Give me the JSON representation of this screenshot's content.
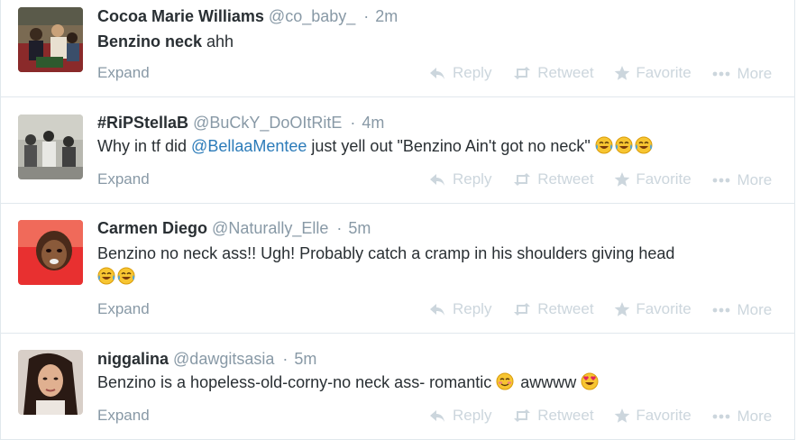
{
  "tweets": [
    {
      "fullname": "Cocoa Marie Williams",
      "username": "@co_baby_",
      "sep": "·",
      "time": "2m",
      "text_bold": "Benzino neck",
      "text_rest": " ahh",
      "expand": "Expand",
      "actions": {
        "reply": "Reply",
        "retweet": "Retweet",
        "favorite": "Favorite",
        "more": "More"
      }
    },
    {
      "fullname": "#RiPStellaB",
      "username": "@BuCkY_DoOItRitE",
      "sep": "·",
      "time": "4m",
      "text_pre": "Why in tf did ",
      "mention": "@BellaaMentee",
      "text_post": " just yell out \"Benzino Ain't got no neck\"",
      "emojis": [
        "face-with-tears-of-joy",
        "face-with-tears-of-joy",
        "face-with-tears-of-joy"
      ],
      "expand": "Expand",
      "actions": {
        "reply": "Reply",
        "retweet": "Retweet",
        "favorite": "Favorite",
        "more": "More"
      }
    },
    {
      "fullname": "Carmen Diego",
      "username": "@Naturally_Elle",
      "sep": "·",
      "time": "5m",
      "text": "Benzino no neck ass!! Ugh! Probably catch a cramp in his shoulders giving head",
      "emojis": [
        "face-with-tears-of-joy",
        "face-with-tears-of-joy"
      ],
      "expand": "Expand",
      "actions": {
        "reply": "Reply",
        "retweet": "Retweet",
        "favorite": "Favorite",
        "more": "More"
      }
    },
    {
      "fullname": "niggalina",
      "username": "@dawgitsasia",
      "sep": "·",
      "time": "5m",
      "text_pre": "Benzino is a hopeless-old-corny-no neck ass- romantic ",
      "text_post": " awwww ",
      "emojis": [
        "smiling-face-with-blush",
        "smiling-face-with-heart-eyes"
      ],
      "expand": "Expand",
      "actions": {
        "reply": "Reply",
        "retweet": "Retweet",
        "favorite": "Favorite",
        "more": "More"
      }
    }
  ],
  "colors": {
    "fullname": "#292f33",
    "meta": "#8899a6",
    "mention": "#2b7bb9",
    "action": "#ccd6dd",
    "border": "#e1e8ed"
  }
}
